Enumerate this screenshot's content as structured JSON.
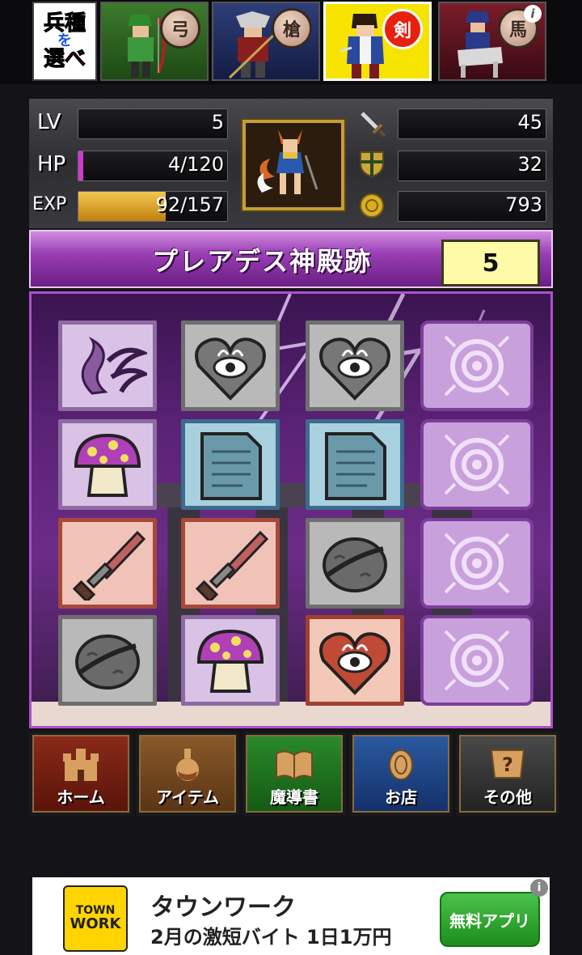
{
  "unit_select": {
    "badge_line1": "兵種",
    "badge_line2": "を",
    "badge_line3": "選べ",
    "tabs": [
      {
        "label": "弓",
        "selected": false
      },
      {
        "label": "槍",
        "selected": false
      },
      {
        "label": "剣",
        "selected": true
      },
      {
        "label": "馬",
        "selected": false
      }
    ],
    "info_icon": "i"
  },
  "status": {
    "lv_label": "LV",
    "lv_value": "5",
    "hp_label": "HP",
    "hp_value": "4/120",
    "hp_fraction": 0.033,
    "exp_label": "EXP",
    "exp_value": "92/157",
    "exp_fraction": 0.586,
    "attack_value": "45",
    "defense_value": "32",
    "gold_value": "793",
    "icons": [
      "sword-icon",
      "shield-icon",
      "coin-icon"
    ]
  },
  "dungeon": {
    "name": "プレアデス神殿跡",
    "floor": "5"
  },
  "board": {
    "rows": [
      [
        "tentacle",
        "heart-eye-grey",
        "heart-eye-grey",
        "facedown"
      ],
      [
        "mushroom",
        "scroll",
        "scroll",
        "facedown"
      ],
      [
        "sword",
        "sword",
        "walnut",
        "facedown"
      ],
      [
        "walnut",
        "mushroom",
        "heart-eye-red",
        "facedown"
      ]
    ]
  },
  "menu": {
    "home": "ホーム",
    "items": "アイテム",
    "grimoire": "魔導書",
    "shop": "お店",
    "other": "その他"
  },
  "ad": {
    "logo_line1": "TOWN",
    "logo_line2": "WORK",
    "title": "タウンワーク",
    "subtitle": "2月の激短バイト 1日1万円",
    "button": "無料アプリ",
    "info": "i"
  },
  "colors": {
    "hp_fill": "#d03ad0",
    "exp_fill": "#d8a018",
    "selected_tab": "#f6e400",
    "board_border": "#b04ed0"
  }
}
